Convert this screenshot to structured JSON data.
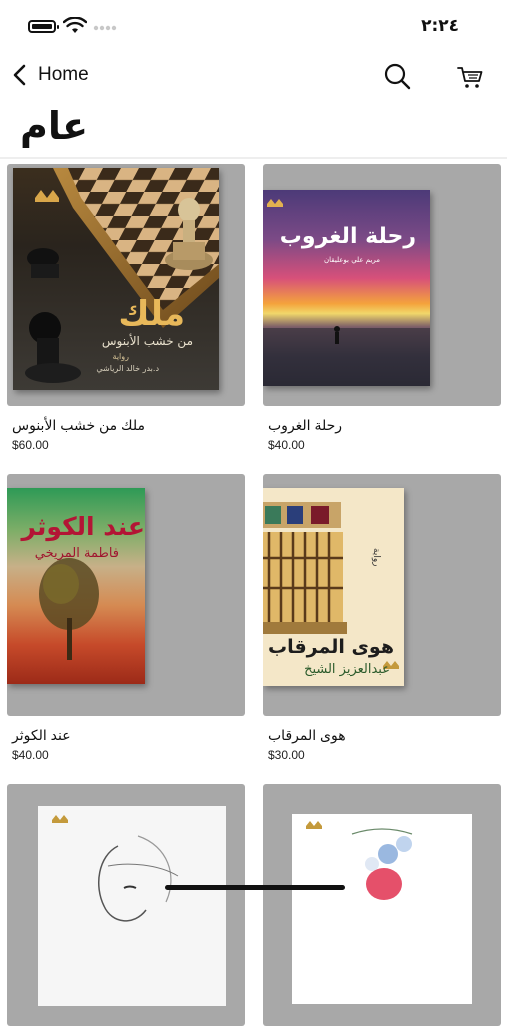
{
  "status": {
    "time": "٢:٢٤"
  },
  "nav": {
    "back_label": "Home"
  },
  "page": {
    "title": "عام"
  },
  "books": [
    {
      "title": "ملك من خشب الأبنوس",
      "price": "$60.00",
      "cover_title": "ملك",
      "cover_subtitle": "من خشب الأبنوس",
      "cover_genre": "رواية",
      "cover_author": "د.بدر خالد الرياشي"
    },
    {
      "title": "رحلة الغروب",
      "price": "$40.00",
      "cover_title": "رحلة الغروب",
      "cover_author": "مريم علي بوعليقان"
    },
    {
      "title": "عند الكوثر",
      "price": "$40.00",
      "cover_title": "عند الكوثر",
      "cover_author": "فاطمة المريخي"
    },
    {
      "title": "هوى المرقاب",
      "price": "$30.00",
      "cover_title": "هوى المرقاب",
      "cover_author": "عبدالعزيز الشيخ",
      "cover_side": "رواية"
    },
    {
      "title": "",
      "price": ""
    },
    {
      "title": "",
      "price": ""
    }
  ]
}
